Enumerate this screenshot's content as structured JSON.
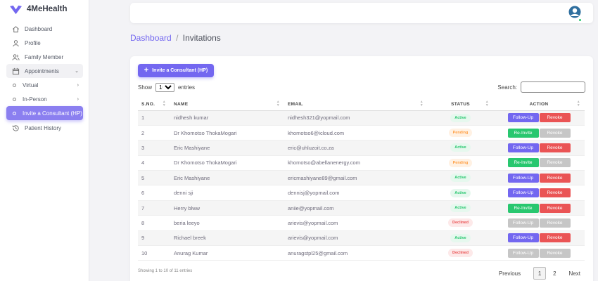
{
  "app": {
    "name": "4MeHealth"
  },
  "sidebar": {
    "items": [
      {
        "label": "Dashboard",
        "icon": "home-icon"
      },
      {
        "label": "Profile",
        "icon": "user-icon"
      },
      {
        "label": "Family Member",
        "icon": "users-icon"
      },
      {
        "label": "Appointments",
        "icon": "calendar-icon"
      },
      {
        "label": "Virtual"
      },
      {
        "label": "In-Person"
      },
      {
        "label": "Invite a Consultant (HP)"
      },
      {
        "label": "Patient History",
        "icon": "history-icon"
      }
    ]
  },
  "breadcrumb": {
    "parent": "Dashboard",
    "separator": "/",
    "current": "Invitations"
  },
  "toolbar": {
    "invite_label": "Invite a Consultant (HP)"
  },
  "table_controls": {
    "show_label": "Show",
    "entries_value": "10",
    "entries_label": "entries",
    "search_label": "Search:"
  },
  "table": {
    "headers": {
      "sno": "S.NO.",
      "name": "NAME",
      "email": "EMAIL",
      "status": "STATUS",
      "action": "ACTION"
    },
    "rows": [
      {
        "sno": "1",
        "name": "nidhesh kumar",
        "email": "nidhesh321@yopmail.com",
        "status": "Active",
        "primary": "Follow-Up",
        "secondary": "Revoke"
      },
      {
        "sno": "2",
        "name": "Dr Khomotso ThokaMogari",
        "email": "khomotso6@icloud.com",
        "status": "Pending",
        "primary": "Re-Invite",
        "secondary": "Revoke"
      },
      {
        "sno": "3",
        "name": "Eric Mashiyane",
        "email": "eric@uhluzoit.co.za",
        "status": "Active",
        "primary": "Follow-Up",
        "secondary": "Revoke"
      },
      {
        "sno": "4",
        "name": "Dr Khomotso ThokaMogari",
        "email": "khomotso@abellanenergy.com",
        "status": "Pending",
        "primary": "Re-Invite",
        "secondary": "Revoke"
      },
      {
        "sno": "5",
        "name": "Eric Mashiyane",
        "email": "ericmashiyane89@gmail.com",
        "status": "Active",
        "primary": "Follow-Up",
        "secondary": "Revoke"
      },
      {
        "sno": "6",
        "name": "denni sji",
        "email": "dennisj@yopmail.com",
        "status": "Active",
        "primary": "Follow-Up",
        "secondary": "Revoke"
      },
      {
        "sno": "7",
        "name": "Herry blww",
        "email": "aniie@yopmail.com",
        "status": "Active",
        "primary": "Re-Invite",
        "secondary": "Revoke"
      },
      {
        "sno": "8",
        "name": "beria leeyo",
        "email": "arievis@yopmail.com",
        "status": "Declined",
        "primary": "Follow-Up",
        "secondary": "Revoke"
      },
      {
        "sno": "9",
        "name": "Richael breek",
        "email": "arievis@yopmail.com",
        "status": "Active",
        "primary": "Follow-Up",
        "secondary": "Revoke"
      },
      {
        "sno": "10",
        "name": "Anurag Kumar",
        "email": "anuragstpl25@gmail.com",
        "status": "Declined",
        "primary": "Follow-Up",
        "secondary": "Revoke"
      }
    ]
  },
  "footer": {
    "info": "Showing 1 to 10 of 11 entries",
    "previous": "Previous",
    "page1": "1",
    "page2": "2",
    "next": "Next"
  },
  "colors": {
    "primary": "#7367f0",
    "success": "#28c76f",
    "danger": "#ea5455",
    "warning": "#ff9f43",
    "disabled": "#c6c6c6"
  }
}
